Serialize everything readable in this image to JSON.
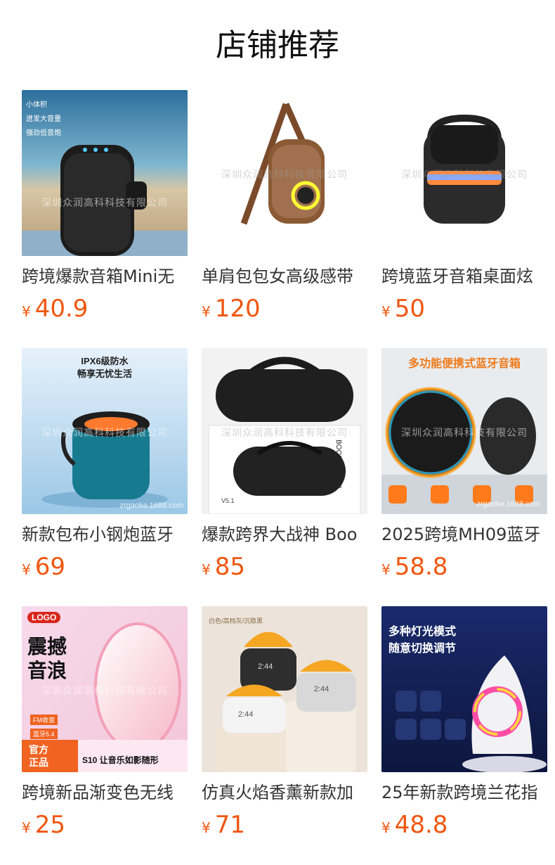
{
  "header": {
    "title": "店铺推荐"
  },
  "currency_symbol": "¥",
  "watermark": "深圳众润高科科技有限公司",
  "watermark_site": "zrgaoke.1688.com",
  "products": [
    {
      "name": "跨境爆款音箱Mini无",
      "price": "40.9",
      "image_text": [
        "小体积",
        "迸发大音量",
        "强劲低音炮"
      ]
    },
    {
      "name": "单肩包包女高级感带",
      "price": "120"
    },
    {
      "name": "跨境蓝牙音箱桌面炫",
      "price": "50"
    },
    {
      "name": "新款包布小钢炮蓝牙",
      "price": "69",
      "image_text": [
        "IPX6级防水",
        "畅享无忧生活"
      ]
    },
    {
      "name": "爆款跨界大战神 Boo",
      "price": "85",
      "image_text": [
        "BOOMS BOX 3",
        "V5.1"
      ]
    },
    {
      "name": "2025跨境MH09蓝牙",
      "price": "58.8",
      "image_text": [
        "多功能便携式蓝牙音箱"
      ]
    },
    {
      "name": "跨境新品渐变色无线",
      "price": "25",
      "image_text": [
        "LOGO",
        "震撼",
        "音浪",
        "官方",
        "正品",
        "S10 让音乐如影随形",
        "FM收音",
        "蓝牙5.4"
      ]
    },
    {
      "name": "仿真火焰香薰新款加",
      "price": "71",
      "image_text": [
        "白色/高档灰/沉稳黑",
        "2:44"
      ]
    },
    {
      "name": "25年新款跨境兰花指",
      "price": "48.8",
      "image_text": [
        "多种灯光模式",
        "随意切换调节"
      ]
    }
  ]
}
